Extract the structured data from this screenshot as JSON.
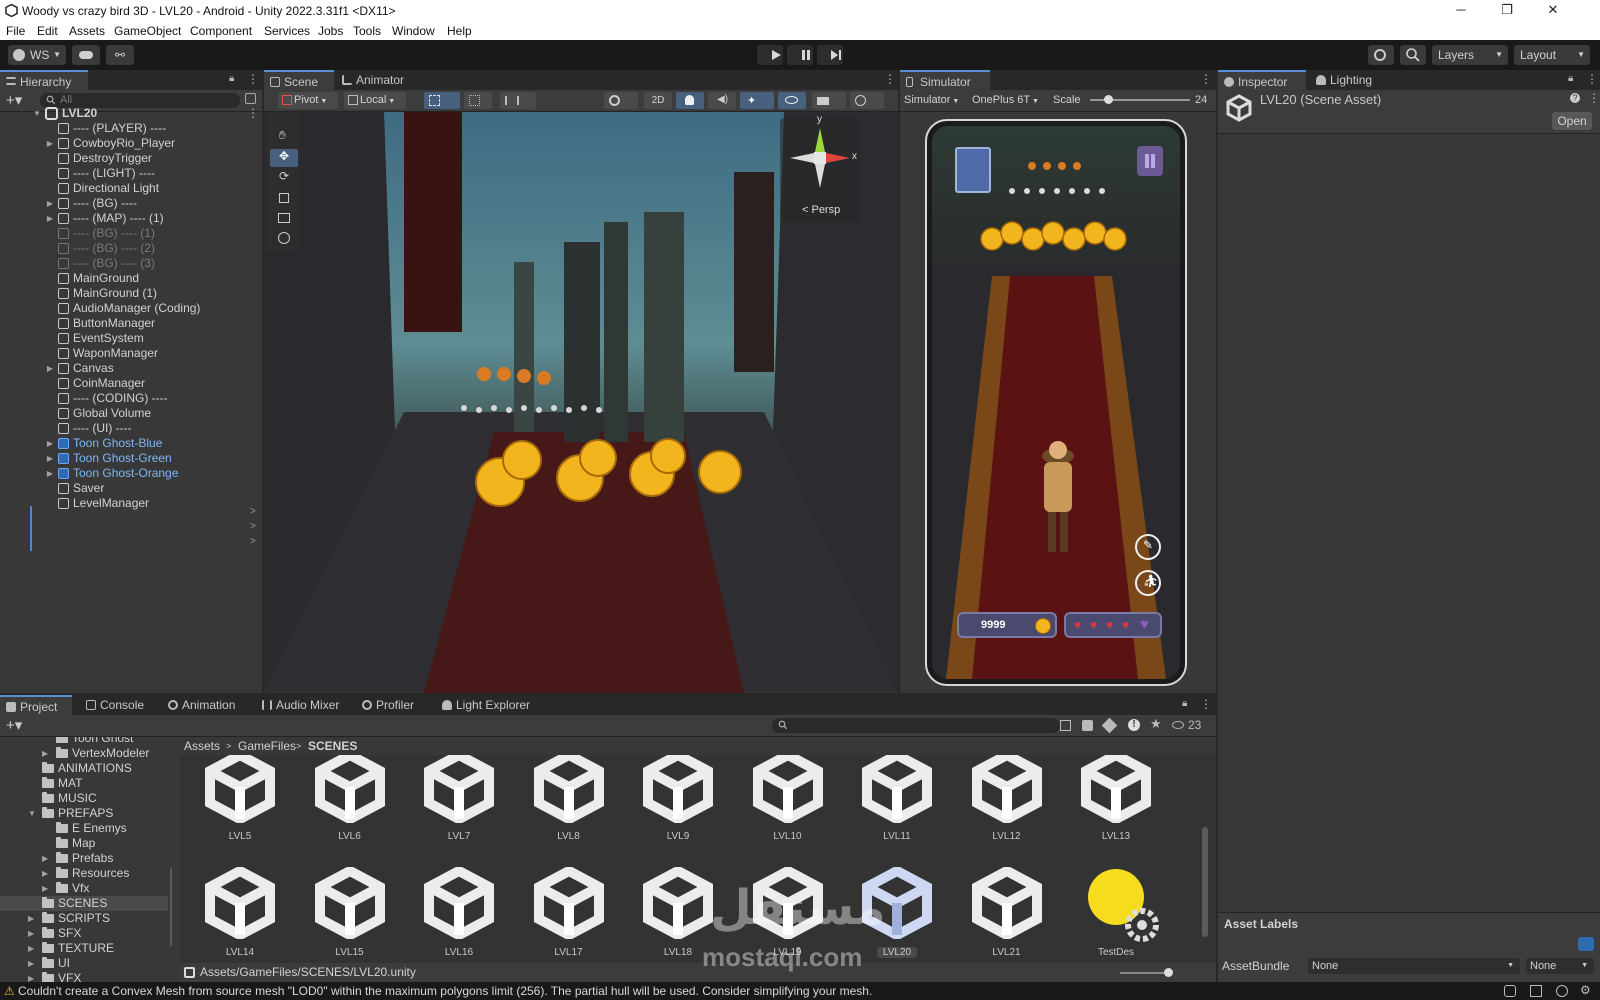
{
  "window": {
    "title": "Woody vs crazy bird 3D - LVL20 - Android - Unity 2022.3.31f1 <DX11>",
    "controls": [
      "─",
      "❐",
      "✕"
    ]
  },
  "menu": [
    "File",
    "Edit",
    "Assets",
    "GameObject",
    "Component",
    "Services",
    "Jobs",
    "Tools",
    "Window",
    "Help"
  ],
  "toolbar": {
    "account": "WS",
    "layers": "Layers",
    "layout": "Layout"
  },
  "hierarchy": {
    "tab": "Hierarchy",
    "search_placeholder": "All",
    "root": "LVL20",
    "items": [
      {
        "label": "---- (PLAYER) ----",
        "expand": false,
        "style": ""
      },
      {
        "label": "CowboyRio_Player",
        "expand": true,
        "style": ""
      },
      {
        "label": "DestroyTrigger",
        "expand": false,
        "style": ""
      },
      {
        "label": "---- (LIGHT) ----",
        "expand": false,
        "style": ""
      },
      {
        "label": "Directional Light",
        "expand": false,
        "style": ""
      },
      {
        "label": "---- (BG) ----",
        "expand": true,
        "style": ""
      },
      {
        "label": "---- (MAP) ---- (1)",
        "expand": true,
        "style": ""
      },
      {
        "label": "---- (BG) ---- (1)",
        "expand": false,
        "style": "dim"
      },
      {
        "label": "---- (BG) ---- (2)",
        "expand": false,
        "style": "dim"
      },
      {
        "label": "---- (BG) ---- (3)",
        "expand": false,
        "style": "dim"
      },
      {
        "label": "MainGround",
        "expand": false,
        "style": ""
      },
      {
        "label": "MainGround (1)",
        "expand": false,
        "style": ""
      },
      {
        "label": "AudioManager (Coding)",
        "expand": false,
        "style": ""
      },
      {
        "label": "ButtonManager",
        "expand": false,
        "style": ""
      },
      {
        "label": "EventSystem",
        "expand": false,
        "style": ""
      },
      {
        "label": "WaponManager",
        "expand": false,
        "style": ""
      },
      {
        "label": "Canvas",
        "expand": true,
        "style": ""
      },
      {
        "label": "CoinManager",
        "expand": false,
        "style": ""
      },
      {
        "label": "---- (CODING) ----",
        "expand": false,
        "style": ""
      },
      {
        "label": "Global Volume",
        "expand": false,
        "style": ""
      },
      {
        "label": "---- (UI) ----",
        "expand": false,
        "style": ""
      },
      {
        "label": "Toon Ghost-Blue",
        "expand": true,
        "style": "prefab"
      },
      {
        "label": "Toon Ghost-Green",
        "expand": true,
        "style": "prefab"
      },
      {
        "label": "Toon Ghost-Orange",
        "expand": true,
        "style": "prefab"
      },
      {
        "label": "Saver",
        "expand": false,
        "style": ""
      },
      {
        "label": "LevelManager",
        "expand": false,
        "style": ""
      }
    ]
  },
  "scene": {
    "tabs": [
      "Scene",
      "Animator"
    ],
    "pivot": "Pivot",
    "local": "Local",
    "mode_2d": "2D",
    "gizmo_y": "y",
    "gizmo_x": "x",
    "persp": "< Persp"
  },
  "simulator": {
    "tab": "Simulator",
    "mode": "Simulator",
    "device": "OnePlus 6T",
    "scale_label": "Scale",
    "scale_value": "24",
    "hud_coins": "9999",
    "hearts": 4
  },
  "inspector": {
    "tabs": [
      "Inspector",
      "Lighting"
    ],
    "title": "LVL20 (Scene Asset)",
    "open_button": "Open",
    "asset_labels": "Asset Labels",
    "asset_bundle_label": "AssetBundle",
    "asset_bundle_value": "None",
    "asset_bundle_variant": "None"
  },
  "project": {
    "tabs": [
      "Project",
      "Console",
      "Animation",
      "Audio Mixer",
      "Profiler",
      "Light Explorer"
    ],
    "hidden_count": "23",
    "breadcrumb": [
      "Assets",
      "GameFiles",
      "SCENES"
    ],
    "tree": [
      {
        "label": "Toon Ghost",
        "indent": 3,
        "arrow": false
      },
      {
        "label": "VertexModeler",
        "indent": 3,
        "arrow": true
      },
      {
        "label": "ANIMATIONS",
        "indent": 2,
        "arrow": false
      },
      {
        "label": "MAT",
        "indent": 2,
        "arrow": false
      },
      {
        "label": "MUSIC",
        "indent": 2,
        "arrow": false
      },
      {
        "label": "PREFAPS",
        "indent": 2,
        "arrow": "open"
      },
      {
        "label": "E Enemys",
        "indent": 3,
        "arrow": false
      },
      {
        "label": "Map",
        "indent": 3,
        "arrow": false
      },
      {
        "label": "Prefabs",
        "indent": 3,
        "arrow": true
      },
      {
        "label": "Resources",
        "indent": 3,
        "arrow": true
      },
      {
        "label": "Vfx",
        "indent": 3,
        "arrow": true
      },
      {
        "label": "SCENES",
        "indent": 2,
        "arrow": false
      },
      {
        "label": "SCRIPTS",
        "indent": 2,
        "arrow": true
      },
      {
        "label": "SFX",
        "indent": 2,
        "arrow": true
      },
      {
        "label": "TEXTURE",
        "indent": 2,
        "arrow": true
      },
      {
        "label": "UI",
        "indent": 2,
        "arrow": true
      },
      {
        "label": "VFX",
        "indent": 2,
        "arrow": true
      }
    ],
    "assets_row1": [
      "LVL5",
      "LVL6",
      "LVL7",
      "LVL8",
      "LVL9",
      "LVL10",
      "LVL11",
      "LVL12",
      "LVL13"
    ],
    "assets_row2": [
      "LVL14",
      "LVL15",
      "LVL16",
      "LVL17",
      "LVL18",
      "LVL19",
      "LVL20",
      "LVL21",
      "TestDes"
    ],
    "selected_asset": "LVL20",
    "path": "Assets/GameFiles/SCENES/LVL20.unity"
  },
  "status": {
    "message": "Couldn't create a Convex Mesh from source mesh \"LOD0\" within the maximum polygons limit (256). The partial hull will be used. Consider simplifying your mesh.",
    "color": "#f0c23c"
  },
  "watermark": {
    "arabic": "مستقل",
    "latin": "mostaql.com"
  }
}
